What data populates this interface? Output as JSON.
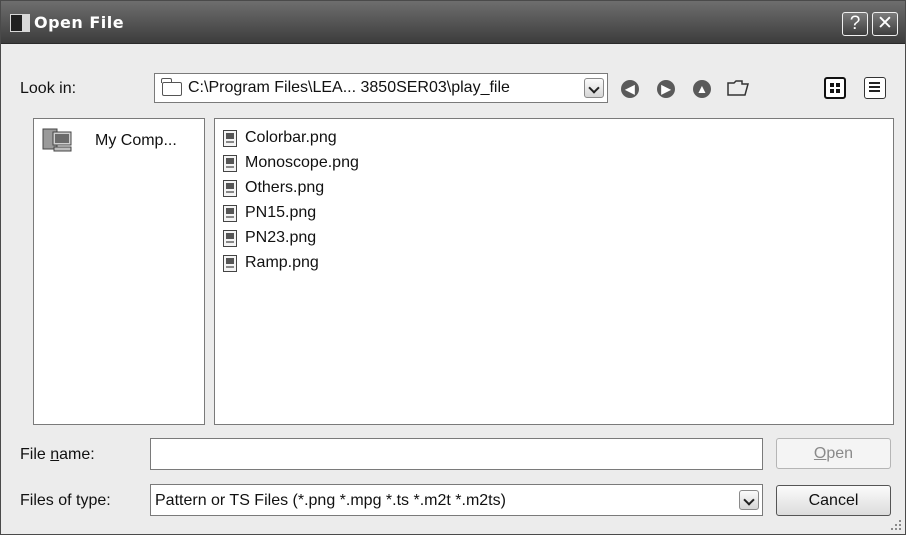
{
  "window": {
    "title": "Open File"
  },
  "titlebar": {
    "help_label": "?",
    "close_label": "✕"
  },
  "look_in": {
    "label": "Look in:",
    "path": "C:\\Program Files\\LEA... 3850SER03\\play_file"
  },
  "toolbar": {
    "back_glyph": "◀",
    "forward_glyph": "▶",
    "up_glyph": "▲"
  },
  "places": [
    {
      "label": "My Comp...",
      "icon": "computer-icon"
    }
  ],
  "files": [
    {
      "name": "Colorbar.png"
    },
    {
      "name": "Monoscope.png"
    },
    {
      "name": "Others.png"
    },
    {
      "name": "PN15.png"
    },
    {
      "name": "PN23.png"
    },
    {
      "name": "Ramp.png"
    }
  ],
  "file_name": {
    "label_prefix": "File ",
    "label_mnemonic": "n",
    "label_suffix": "ame:",
    "value": ""
  },
  "file_type": {
    "label": "Files of type:",
    "value": "Pattern or TS Files (*.png *.mpg *.ts *.m2t *.m2ts)"
  },
  "buttons": {
    "open_mnemonic": "O",
    "open_rest": "pen",
    "cancel": "Cancel"
  },
  "colors": {
    "titlebar": "#3c3c3c",
    "dialog_bg": "#ececec",
    "disabled_text": "#8a8a8a"
  }
}
